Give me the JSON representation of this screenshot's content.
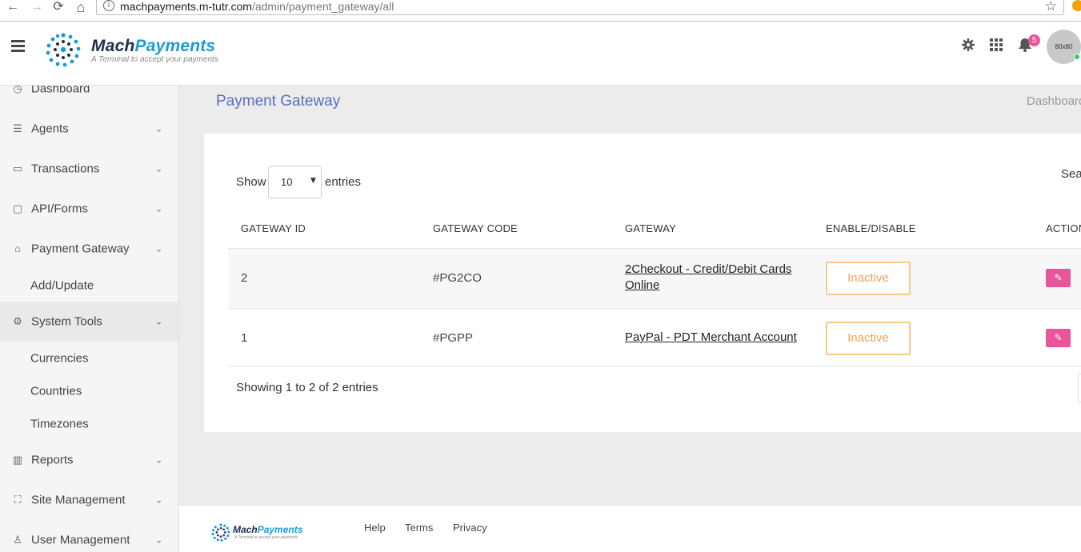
{
  "browser": {
    "url_host": "machpayments.m-tutr.com",
    "url_path": "/admin/payment_gateway/all",
    "back_icon": "←",
    "forward_icon": "→",
    "reload_icon": "⟳",
    "home_icon": "⌂",
    "info_icon": "i",
    "star_icon": "☆"
  },
  "header": {
    "brand_mach": "Mach",
    "brand_payments": "Payments",
    "tagline": "A Terminal to accept your payments",
    "notification_count": "5",
    "avatar_text": "80x80",
    "accent_color": "#1a9bd7",
    "badge_color": "#e8559b"
  },
  "sidebar": {
    "items": [
      {
        "label": "Dashboard",
        "icon": "dashboard-icon"
      },
      {
        "label": "Agents",
        "icon": "list-icon"
      },
      {
        "label": "Transactions",
        "icon": "transactions-icon"
      },
      {
        "label": "API/Forms",
        "icon": "monitor-icon"
      },
      {
        "label": "Payment Gateway",
        "icon": "bag-icon"
      },
      {
        "label": "Add/Update"
      },
      {
        "label": "System Tools",
        "icon": "gear-icon"
      },
      {
        "label": "Currencies"
      },
      {
        "label": "Countries"
      },
      {
        "label": "Timezones"
      },
      {
        "label": "Reports",
        "icon": "chart-icon"
      },
      {
        "label": "Site Management",
        "icon": "frame-icon"
      },
      {
        "label": "User Management",
        "icon": "user-icon"
      }
    ]
  },
  "page": {
    "title": "Payment Gateway",
    "breadcrumb": "Dashboard"
  },
  "table": {
    "show_label": "Show",
    "page_size": "10",
    "entries_label": "entries",
    "search_label": "Search:",
    "columns": [
      "GATEWAY ID",
      "GATEWAY CODE",
      "GATEWAY",
      "ENABLE/DISABLE",
      "ACTION"
    ],
    "rows": [
      {
        "id": "2",
        "code": "#PG2CO",
        "gateway": "2Checkout - Credit/Debit Cards Online",
        "status": "Inactive"
      },
      {
        "id": "1",
        "code": "#PGPP",
        "gateway": "PayPal - PDT Merchant Account",
        "status": "Inactive"
      }
    ],
    "info": "Showing 1 to 2 of 2 entries",
    "status_color": "#f0a35a",
    "edit_color": "#e8559b"
  },
  "footer": {
    "brand_mach": "Mach",
    "brand_payments": "Payments",
    "tagline": "A Terminal to accept your payments",
    "links": [
      "Help",
      "Terms",
      "Privacy"
    ]
  }
}
